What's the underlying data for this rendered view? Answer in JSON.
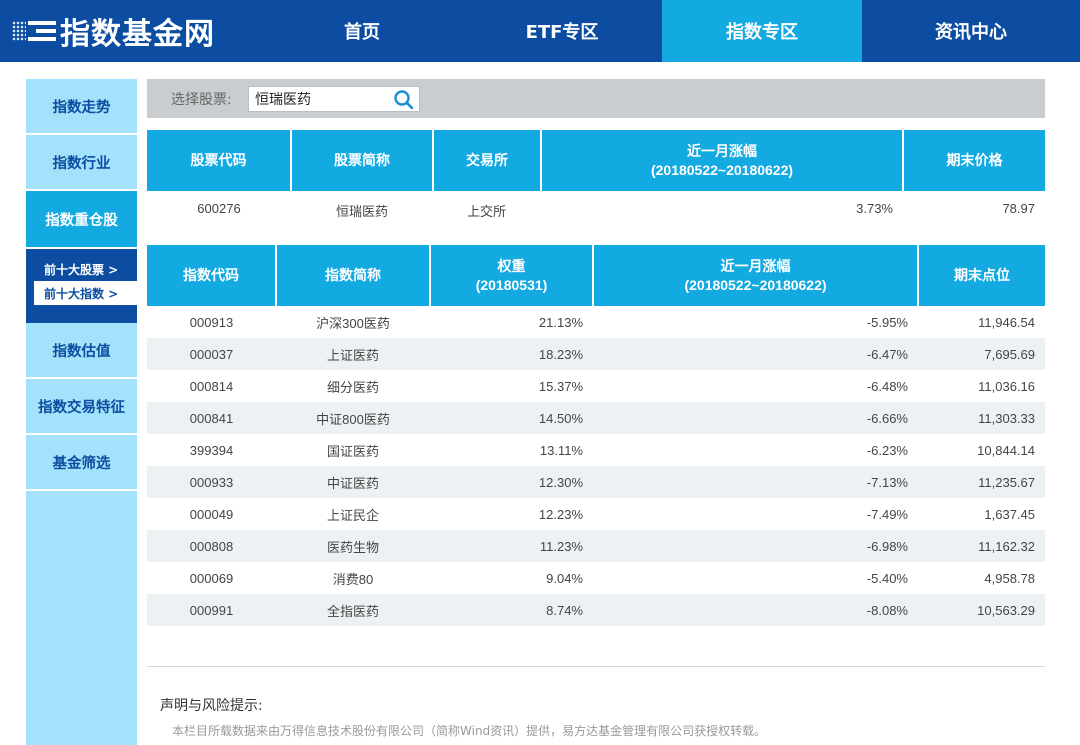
{
  "header": {
    "logo_text": "指数基金网",
    "nav": [
      {
        "label": "首页"
      },
      {
        "label": "ETF专区"
      },
      {
        "label": "指数专区",
        "active": true
      },
      {
        "label": "资讯中心"
      }
    ]
  },
  "sidebar": {
    "items": [
      {
        "label": "指数走势"
      },
      {
        "label": "指数行业"
      },
      {
        "label": "指数重仓股",
        "active": true
      },
      {
        "label": "指数估值"
      },
      {
        "label": "指数交易特征"
      },
      {
        "label": "基金筛选"
      }
    ],
    "subitems": [
      {
        "label": "前十大股票 >"
      },
      {
        "label": "前十大指数 >",
        "selected": true
      }
    ]
  },
  "search": {
    "label": "选择股票:",
    "value": "恒瑞医药",
    "icon": "search-icon"
  },
  "stock_table": {
    "headers": [
      "股票代码",
      "股票简称",
      "交易所",
      "近一月涨幅",
      "(20180522~20180622)",
      "期末价格"
    ],
    "row": {
      "code": "600276",
      "name": "恒瑞医药",
      "exchange": "上交所",
      "change": "3.73%",
      "price": "78.97"
    }
  },
  "index_table": {
    "headers": {
      "code": "指数代码",
      "name": "指数简称",
      "weight": "权重",
      "weight_date": "(20180531)",
      "change": "近一月涨幅",
      "change_range": "(20180522~20180622)",
      "close": "期末点位"
    },
    "rows": [
      {
        "code": "000913",
        "name": "沪深300医药",
        "weight": "21.13%",
        "change": "-5.95%",
        "close": "11,946.54"
      },
      {
        "code": "000037",
        "name": "上证医药",
        "weight": "18.23%",
        "change": "-6.47%",
        "close": "7,695.69"
      },
      {
        "code": "000814",
        "name": "细分医药",
        "weight": "15.37%",
        "change": "-6.48%",
        "close": "11,036.16"
      },
      {
        "code": "000841",
        "name": "中证800医药",
        "weight": "14.50%",
        "change": "-6.66%",
        "close": "11,303.33"
      },
      {
        "code": "399394",
        "name": "国证医药",
        "weight": "13.11%",
        "change": "-6.23%",
        "close": "10,844.14"
      },
      {
        "code": "000933",
        "name": "中证医药",
        "weight": "12.30%",
        "change": "-7.13%",
        "close": "11,235.67"
      },
      {
        "code": "000049",
        "name": "上证民企",
        "weight": "12.23%",
        "change": "-7.49%",
        "close": "1,637.45"
      },
      {
        "code": "000808",
        "name": "医药生物",
        "weight": "11.23%",
        "change": "-6.98%",
        "close": "11,162.32"
      },
      {
        "code": "000069",
        "name": "消费80",
        "weight": "9.04%",
        "change": "-5.40%",
        "close": "4,958.78"
      },
      {
        "code": "000991",
        "name": "全指医药",
        "weight": "8.74%",
        "change": "-8.08%",
        "close": "10,563.29"
      }
    ]
  },
  "notice": {
    "title": "声明与风险提示:",
    "text": "本栏目所载数据来由万得信息技术股份有限公司（简称Wind资讯）提供，易方达基金管理有限公司获授权转载。"
  },
  "colors": {
    "brand_blue": "#0c4da1",
    "accent_cyan": "#13a9e1",
    "sidebar_light": "#a4e2fb",
    "row_stripe": "#ecf2f3"
  }
}
